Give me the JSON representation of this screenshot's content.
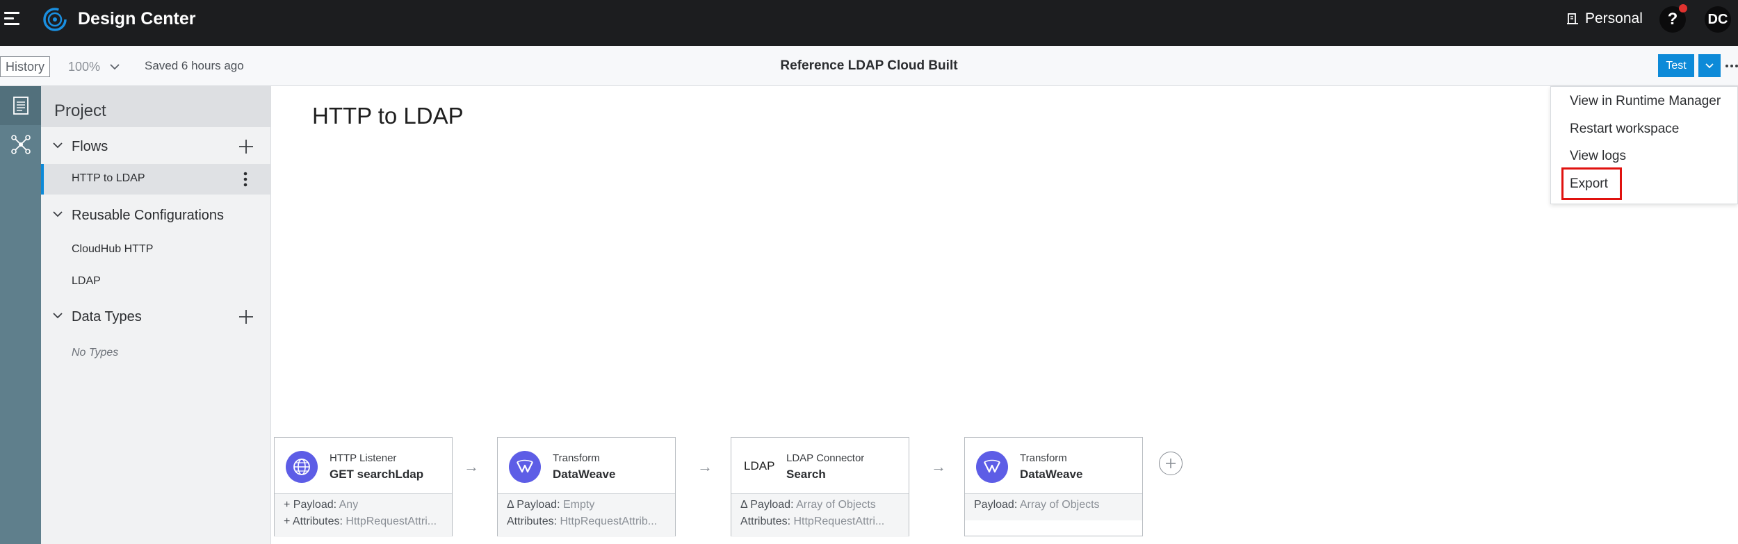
{
  "header": {
    "app_title": "Design Center",
    "workspace_label": "Personal",
    "help_label": "?",
    "avatar_initials": "DC"
  },
  "toolbar": {
    "history_label": "History",
    "zoom_value": "100%",
    "saved_status": "Saved 6 hours ago",
    "project_title": "Reference LDAP Cloud Built",
    "test_label": "Test"
  },
  "panel": {
    "title": "Project",
    "flows_label": "Flows",
    "flows": [
      {
        "label": "HTTP to LDAP",
        "selected": true
      }
    ],
    "reusable_label": "Reusable Configurations",
    "configurations": [
      {
        "label": "CloudHub HTTP"
      },
      {
        "label": "LDAP"
      }
    ],
    "data_types_label": "Data Types",
    "no_types_label": "No Types"
  },
  "canvas": {
    "flow_title": "HTTP to LDAP",
    "steps": [
      {
        "kind": "HTTP Listener",
        "name": "GET searchLdap",
        "icon": "globe-icon",
        "rows": [
          {
            "prefix": "+ ",
            "key": "Payload:",
            "value": "Any"
          },
          {
            "prefix": "+ ",
            "key": "Attributes:",
            "value": "HttpRequestAttri..."
          }
        ]
      },
      {
        "kind": "Transform",
        "name": "DataWeave",
        "icon": "dataweave-icon",
        "rows": [
          {
            "prefix": "Δ ",
            "key": "Payload:",
            "value": "Empty"
          },
          {
            "prefix": "",
            "key": "Attributes:",
            "value": "HttpRequestAttrib..."
          }
        ]
      },
      {
        "kind": "LDAP Connector",
        "name": "Search",
        "icon": "ldap-text",
        "icon_text": "LDAP",
        "rows": [
          {
            "prefix": "Δ ",
            "key": "Payload:",
            "value": "Array of Objects"
          },
          {
            "prefix": "",
            "key": "Attributes:",
            "value": "HttpRequestAttri..."
          }
        ]
      },
      {
        "kind": "Transform",
        "name": "DataWeave",
        "icon": "dataweave-icon",
        "rows": [
          {
            "prefix": "",
            "key": "Payload:",
            "value": "Array of Objects"
          }
        ]
      }
    ]
  },
  "menu": {
    "items": [
      {
        "label": "View in Runtime Manager"
      },
      {
        "label": "Restart workspace"
      },
      {
        "label": "View logs"
      },
      {
        "label": "Export",
        "highlighted": true
      }
    ]
  },
  "colors": {
    "accent": "#0d8ad8",
    "rail": "#5f7f8c",
    "topbar": "#1c1d1f",
    "step_icon": "#5d5de6",
    "highlight": "#e0120f"
  }
}
